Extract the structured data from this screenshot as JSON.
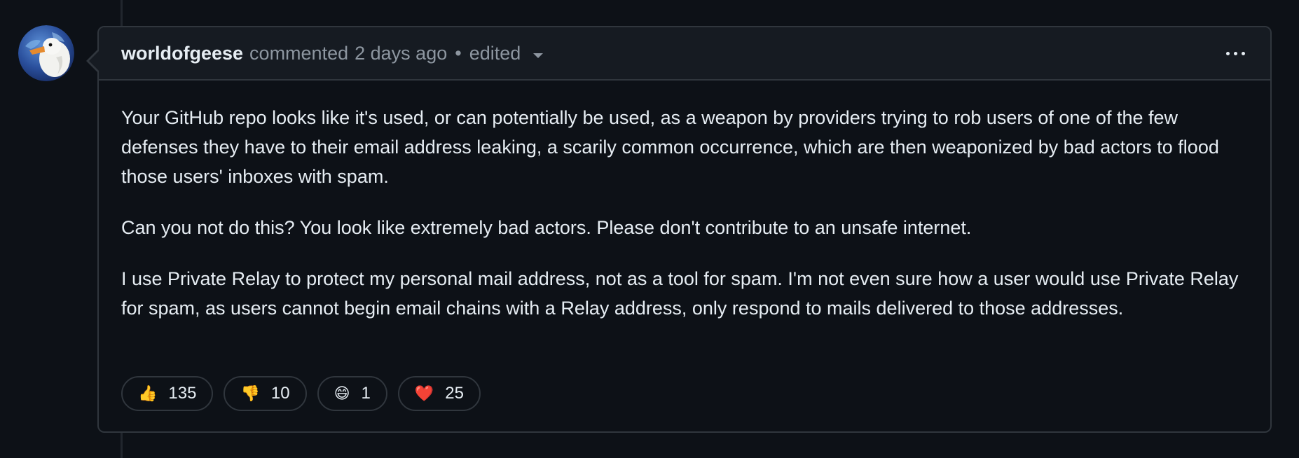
{
  "comment": {
    "author": "worldofgeese",
    "action": "commented",
    "time": "2 days ago",
    "separator": "•",
    "edited": "edited",
    "paragraphs": [
      "Your GitHub repo looks like it's used, or can potentially be used, as a weapon by providers trying to rob users of one of the few defenses they have to their email address leaking, a scarily common occurrence, which are then weaponized by bad actors to flood those users' inboxes with spam.",
      "Can you not do this? You look like extremely bad actors. Please don't contribute to an unsafe internet.",
      "I use Private Relay to protect my personal mail address, not as a tool for spam. I'm not even sure how a user would use Private Relay for spam, as users cannot begin email chains with a Relay address, only respond to mails delivered to those addresses."
    ],
    "reactions": [
      {
        "icon": "thumbs-up-icon",
        "emoji": "👍",
        "count": "135"
      },
      {
        "icon": "thumbs-down-icon",
        "emoji": "👎",
        "count": "10"
      },
      {
        "icon": "laugh-icon",
        "emoji": "😄",
        "count": "1"
      },
      {
        "icon": "heart-icon",
        "emoji": "❤️",
        "count": "25"
      }
    ]
  },
  "colors": {
    "background": "#0d1117",
    "header_bg": "#161b22",
    "border": "#30363d",
    "text": "#e6edf3",
    "muted": "#8d96a0"
  }
}
